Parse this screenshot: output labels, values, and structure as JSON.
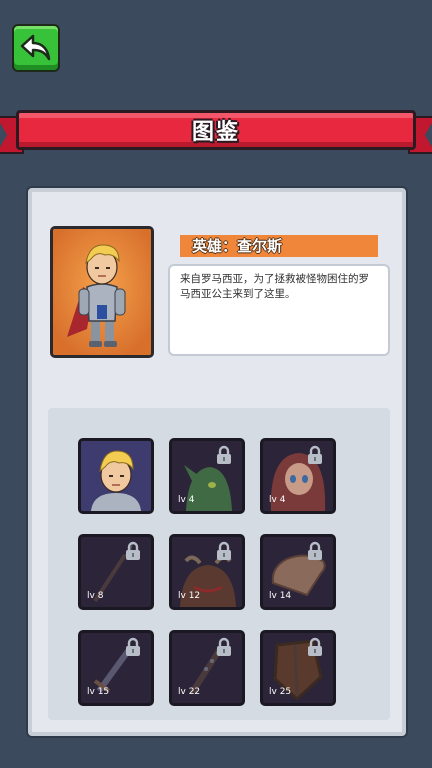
{
  "header": {
    "title": "图鉴"
  },
  "hero": {
    "name": "英雄：查尔斯",
    "description": "来自罗马西亚，为了拯救被怪物困住的罗马西亚公主来到了这里。"
  },
  "collection": [
    {
      "name": "hero-charles",
      "level": "",
      "locked": false
    },
    {
      "name": "goblin",
      "level": "lv 4",
      "locked": true
    },
    {
      "name": "princess",
      "level": "lv 4",
      "locked": true
    },
    {
      "name": "spear",
      "level": "lv 8",
      "locked": true
    },
    {
      "name": "minotaur",
      "level": "lv 12",
      "locked": true
    },
    {
      "name": "bread",
      "level": "lv 14",
      "locked": true
    },
    {
      "name": "sword",
      "level": "lv 15",
      "locked": true
    },
    {
      "name": "spiked-club",
      "level": "lv 22",
      "locked": true
    },
    {
      "name": "shield",
      "level": "lv 25",
      "locked": true
    }
  ],
  "colors": {
    "background": "#3b4a5c",
    "banner": "#e8283f",
    "back_button": "#37c23a",
    "name_bar": "#f0863a"
  }
}
